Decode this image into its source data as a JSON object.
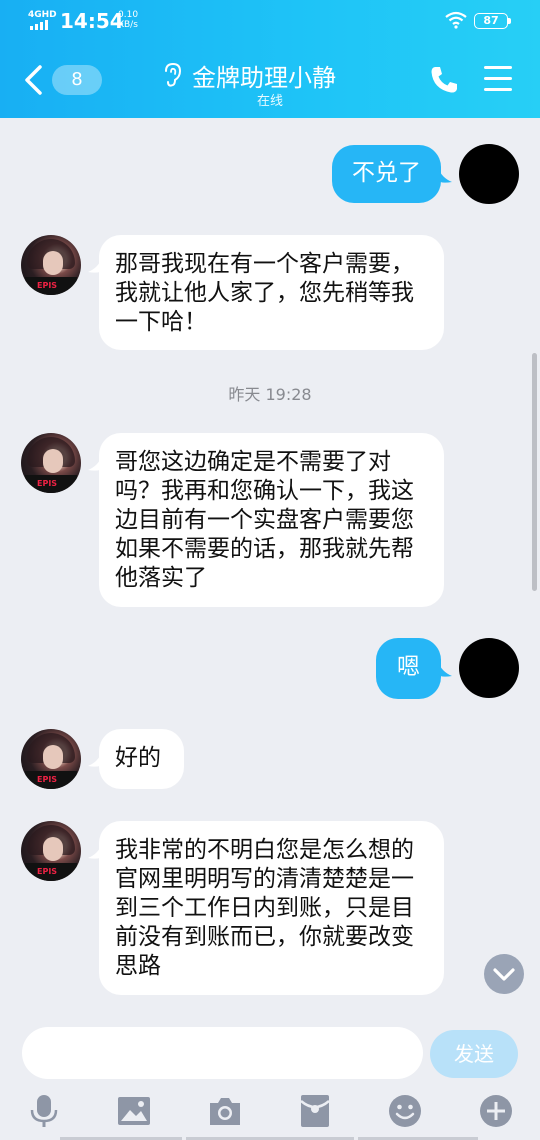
{
  "status_bar": {
    "network": "4GHD",
    "time": "14:54",
    "speed_value": "0.10",
    "speed_unit": "KB/s",
    "battery": "87"
  },
  "header": {
    "unread_count": "8",
    "title": "金牌助理小静",
    "subtitle": "在线",
    "icons": [
      "back-chevron-icon",
      "ear-icon",
      "phone-icon",
      "menu-icon"
    ]
  },
  "messages": [
    {
      "side": "out",
      "text": "不兑了"
    },
    {
      "side": "in",
      "text": "那哥我现在有一个客户需要，我就让他人家了，您先稍等我一下哈！"
    },
    {
      "side": "time",
      "text": "昨天 19:28"
    },
    {
      "side": "in",
      "text": "哥您这边确定是不需要了对吗？我再和您确认一下，我这边目前有一个实盘客户需要您如果不需要的话，那我就先帮他落实了"
    },
    {
      "side": "out",
      "text": "嗯"
    },
    {
      "side": "in",
      "text": "好的"
    },
    {
      "side": "in",
      "text": "我非常的不明白您是怎么想的 官网里明明写的清清楚楚是一到三个工作日内到账，只是目前没有到账而已，你就要改变思路"
    }
  ],
  "composer": {
    "placeholder": "",
    "send_label": "发送"
  },
  "toolbar": [
    "microphone-icon",
    "image-icon",
    "camera-icon",
    "red-packet-icon",
    "emoji-icon",
    "plus-icon"
  ],
  "colors": {
    "header_start": "#18aff3",
    "header_end": "#27cff6",
    "outgoing_bubble": "#26b6f6",
    "incoming_bubble": "#ffffff",
    "background": "#eceef3",
    "send_disabled": "#b8e1f9"
  }
}
